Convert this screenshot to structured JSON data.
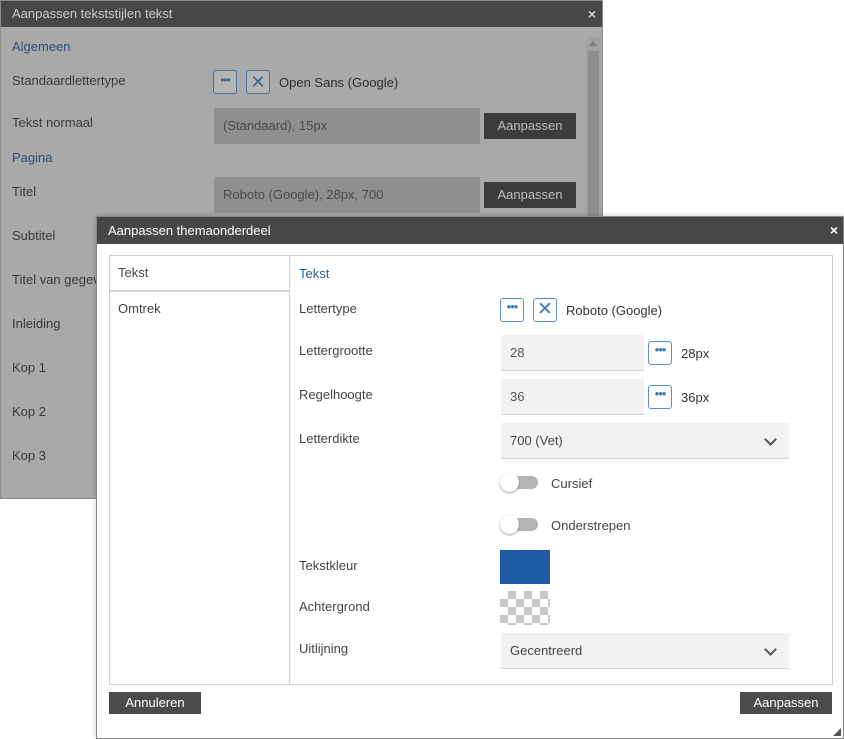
{
  "back_dialog": {
    "title": "Aanpassen tekststijlen tekst",
    "close": "×",
    "section_general": "Algemeen",
    "label_default_font": "Standaardlettertype",
    "default_font_value": "Open Sans (Google)",
    "label_text_normal": "Tekst normaal",
    "text_normal_value": "(Standaard), 15px",
    "section_page": "Pagina",
    "label_title": "Titel",
    "title_value": "Roboto (Google), 28px, 700",
    "adjust_button": "Aanpassen",
    "label_subtitle": "Subtitel",
    "label_data_title": "Titel van gegeve",
    "label_intro": "Inleiding",
    "label_h1": "Kop 1",
    "label_h2": "Kop 2",
    "label_h3": "Kop 3"
  },
  "front_dialog": {
    "title": "Aanpassen themaonderdeel",
    "close": "×",
    "nav": [
      {
        "label": "Tekst"
      },
      {
        "label": "Omtrek"
      }
    ],
    "section": "Tekst",
    "font_label": "Lettertype",
    "font_value": "Roboto (Google)",
    "size_label": "Lettergrootte",
    "size_value": "28",
    "size_display": "28px",
    "line_height_label": "Regelhoogte",
    "line_height_value": "36",
    "line_height_display": "36px",
    "weight_label": "Letterdikte",
    "weight_value": "700 (Vet)",
    "italic_label": "Cursief",
    "underline_label": "Onderstrepen",
    "text_color_label": "Tekstkleur",
    "text_color": "#1f5aa6",
    "background_label": "Achtergrond",
    "align_label": "Uitlijning",
    "align_value": "Gecentreerd",
    "cancel_button": "Annuleren",
    "apply_button": "Aanpassen"
  },
  "icons": {
    "more": "•••",
    "clear": "✕"
  }
}
